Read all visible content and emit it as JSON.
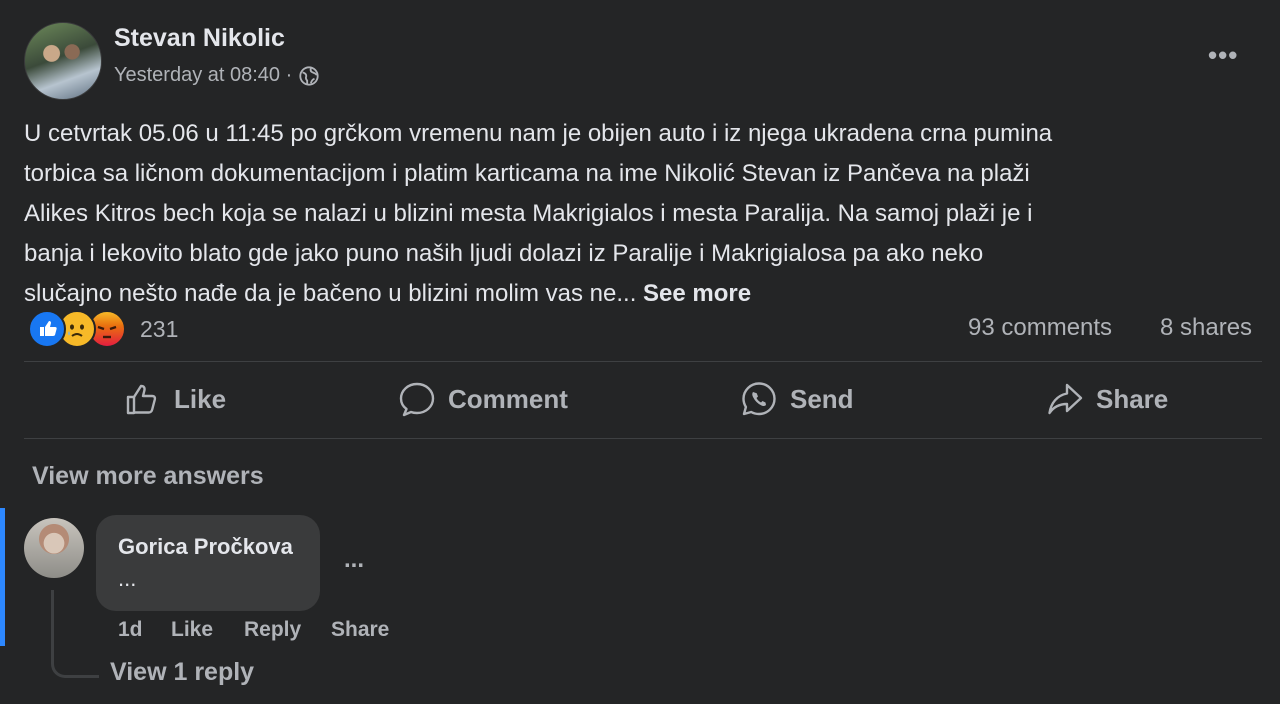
{
  "post": {
    "author": "Stevan Nikolic",
    "timestamp": "Yesterday at 08:40 ·",
    "audience_icon": "globe-icon",
    "options_icon": "•••",
    "text": "U cetvrtak 05.06 u 11:45 po grčkom vremenu nam je obijen auto i iz njega ukradena crna pumina\ntorbica sa ličnom dokumentacijom i platim karticama na ime Nikolić Stevan iz Pančeva na plaži\nAlikes Kitros bech koja se nalazi u blizini mesta Makrigialos i mesta Paralija. Na samoj plaži je i\nbanja i lekovito blato gde jako puno naših ljudi dolazi iz Paralije i Makrigialosa pa ako neko\nslučajno nešto nađe da je bačeno u blizini molim vas ne... ",
    "see_more": "See more"
  },
  "stats": {
    "reaction_icons": [
      "like-icon",
      "sad-icon",
      "angry-icon"
    ],
    "reaction_count": "231",
    "comments": "93 comments",
    "shares": "8 shares"
  },
  "actions": {
    "like": "Like",
    "comment": "Comment",
    "send": "Send",
    "share": "Share"
  },
  "comments_section": {
    "view_more": "View more answers",
    "comment": {
      "author": "Gorica Pročkova",
      "text": "...",
      "options_icon": "...",
      "age": "1d",
      "like": "Like",
      "reply": "Reply",
      "share": "Share",
      "view_replies": "View 1 reply"
    }
  },
  "colors": {
    "background": "#242526",
    "text_primary": "#e4e6eb",
    "text_secondary": "#b0b3b8",
    "bubble": "#3a3b3c",
    "accent": "#2d88ff"
  }
}
